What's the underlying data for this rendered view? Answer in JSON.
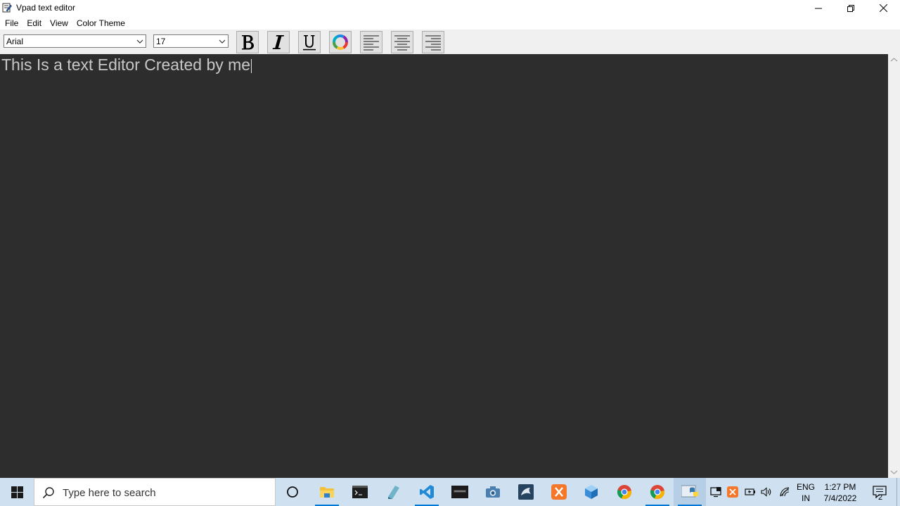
{
  "window": {
    "title": "Vpad text editor"
  },
  "menu": {
    "items": [
      "File",
      "Edit",
      "View",
      "Color Theme"
    ]
  },
  "toolbar": {
    "font_family_value": "Arial",
    "font_size_value": "17"
  },
  "editor": {
    "content": "This Is a text Editor Created by me",
    "background": "#2d2d2d",
    "text_color": "#c7c7c7"
  },
  "taskbar": {
    "search_placeholder": "Type here to search",
    "language_line1": "ENG",
    "language_line2": "IN",
    "time": "1:27 PM",
    "date": "7/4/2022",
    "notification_count": "2"
  }
}
